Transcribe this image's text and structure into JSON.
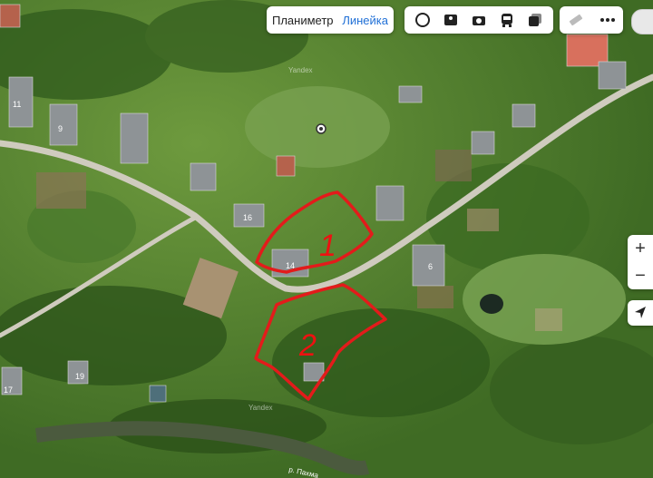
{
  "measure": {
    "planimeter_label": "Планиметр",
    "ruler_label": "Линейка"
  },
  "layer_buttons": [
    {
      "icon": "satellite-icon"
    },
    {
      "icon": "panorama-icon"
    },
    {
      "icon": "photo-icon"
    },
    {
      "icon": "transport-icon"
    },
    {
      "icon": "layers-icon"
    }
  ],
  "tool_buttons": [
    {
      "icon": "ruler-icon"
    },
    {
      "icon": "more-icon"
    }
  ],
  "zoom": {
    "in_label": "+",
    "out_label": "−"
  },
  "watermarks": [
    "Yandex",
    "Yandex"
  ],
  "house_numbers": [
    "11",
    "9",
    "16",
    "14",
    "6",
    "19",
    "17"
  ],
  "plot_labels": [
    "1",
    "2"
  ],
  "river_label": "р. Пахма",
  "colors": {
    "plot_outline": "#e31b1b",
    "active_tool": "#1f6fd6",
    "road": "#cfcbbe"
  }
}
